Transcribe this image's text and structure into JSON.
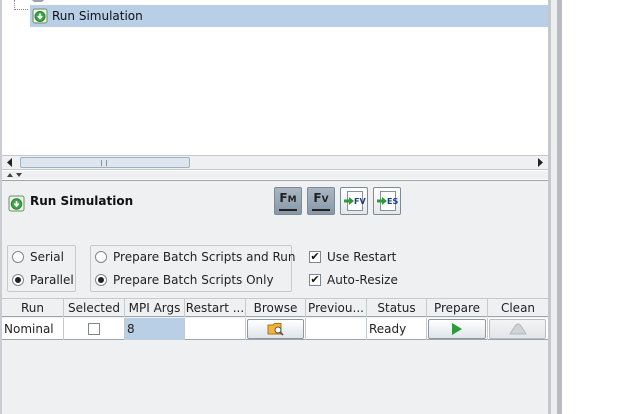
{
  "tree": {
    "selected_item": "Run Simulation",
    "item_icon": "run-simulation-icon"
  },
  "panel": {
    "title": "Run Simulation",
    "toolbar": [
      {
        "name": "fm-button",
        "text": "F",
        "sub": "M",
        "icon": "field-m-icon"
      },
      {
        "name": "fv-button",
        "text": "F",
        "sub": "V",
        "icon": "field-v-icon"
      },
      {
        "name": "prepare-fv-button",
        "text": "FV",
        "icon": "arrow-doc-fv-icon"
      },
      {
        "name": "prepare-es-button",
        "text": "ES",
        "icon": "arrow-doc-es-icon"
      }
    ]
  },
  "options": {
    "mode_serial": "Serial",
    "mode_parallel": "Parallel",
    "mode_selected": "Parallel",
    "prepare_run": "Prepare Batch Scripts and Run",
    "prepare_only": "Prepare Batch Scripts Only",
    "prepare_selected": "Prepare Batch Scripts Only",
    "use_restart": "Use Restart",
    "use_restart_checked": true,
    "auto_resize": "Auto-Resize",
    "auto_resize_checked": true
  },
  "table": {
    "columns": [
      "Run",
      "Selected",
      "MPI Args",
      "Restart ...",
      "Browse",
      "Previou...",
      "Status",
      "Prepare",
      "Clean"
    ],
    "rows": [
      {
        "run": "Nominal",
        "selected": false,
        "mpi_args": "8",
        "restart": "",
        "previous": "",
        "status": "Ready"
      }
    ]
  },
  "colors": {
    "selection": "#b8cfe5",
    "panel_bg": "#eef0f2",
    "run_green": "#2e9b3a"
  }
}
